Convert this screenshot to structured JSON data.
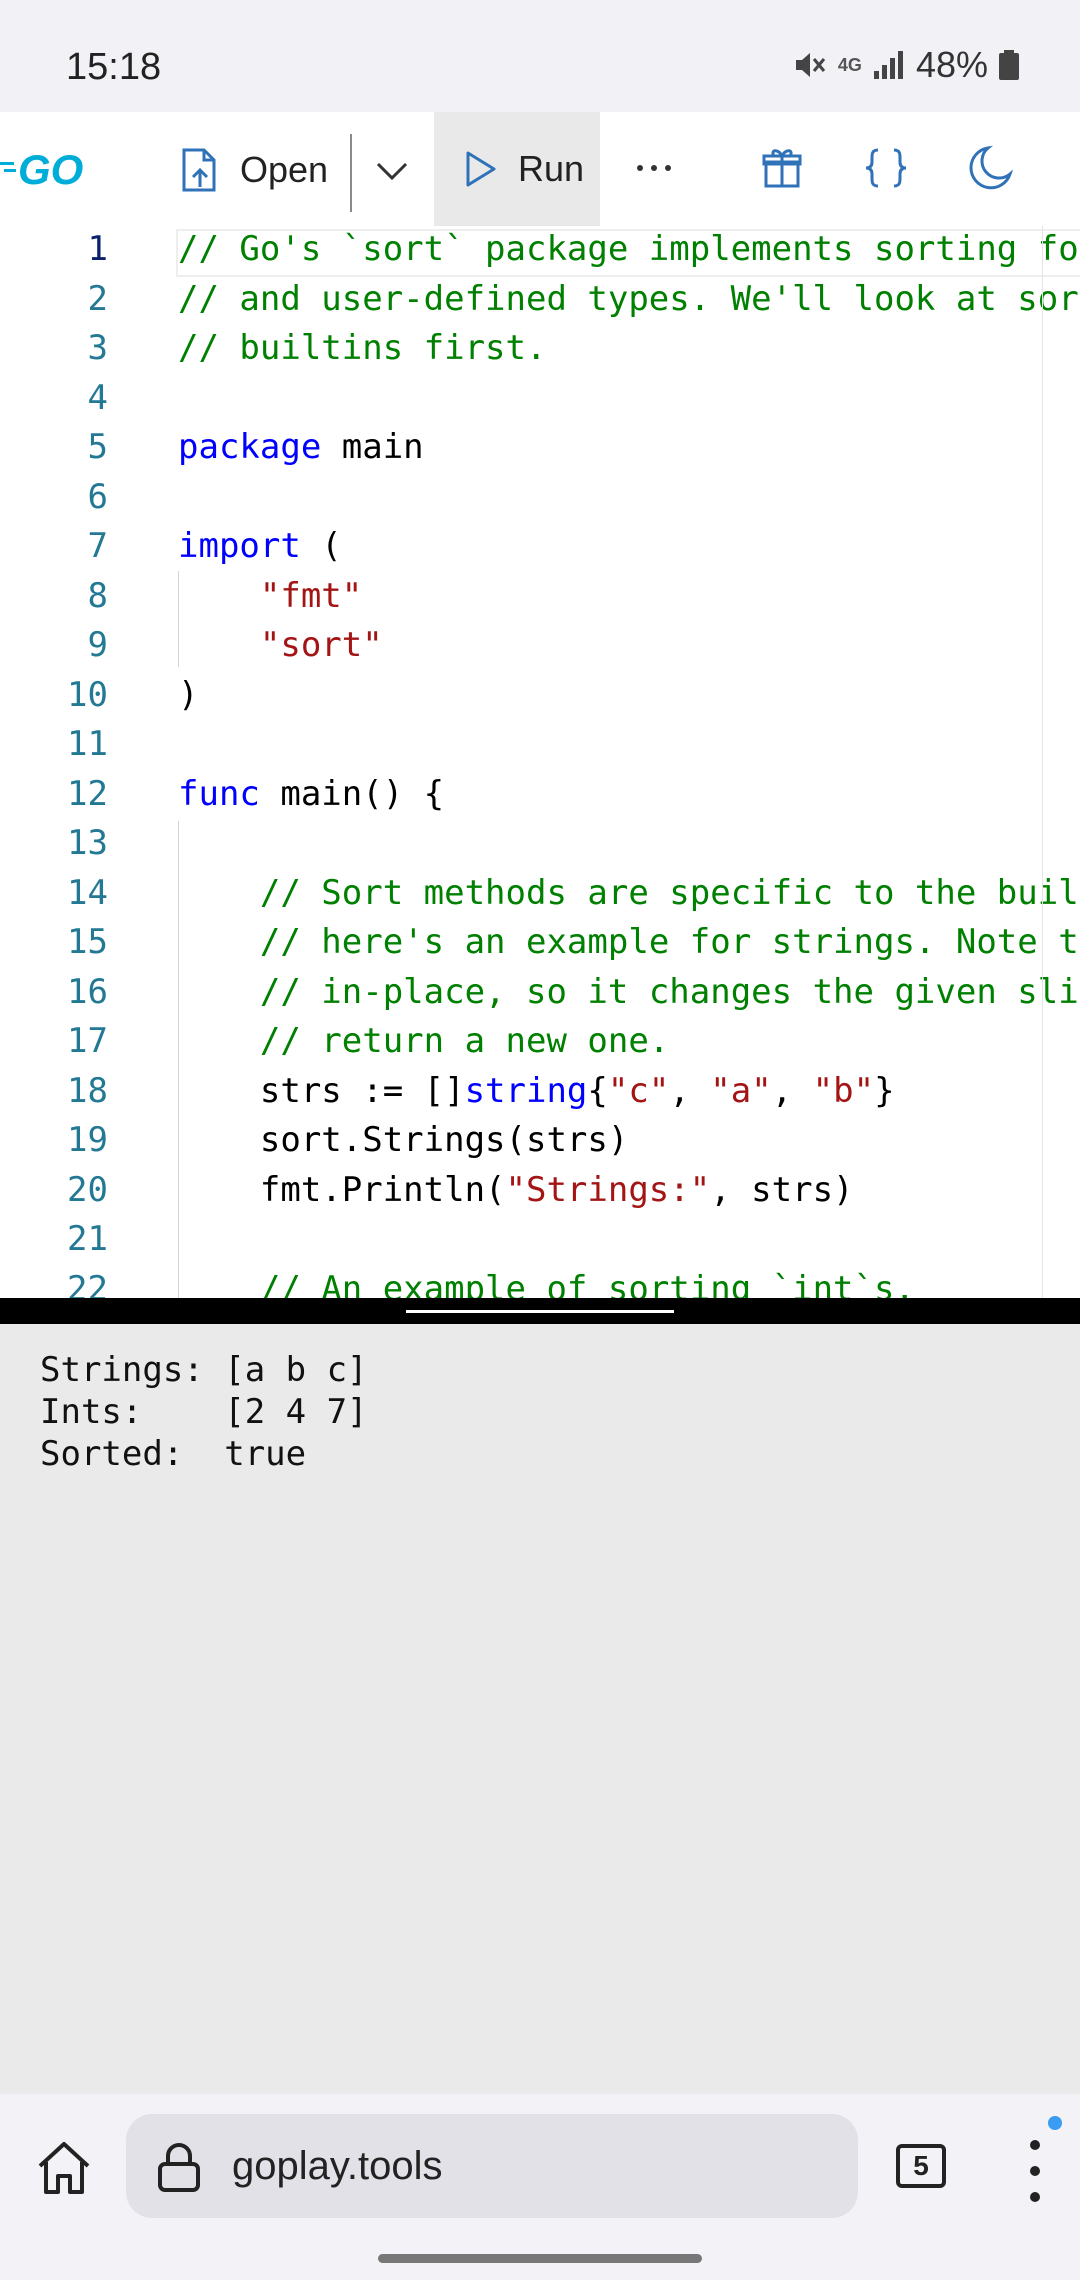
{
  "status_bar": {
    "time": "15:18",
    "network": "4G",
    "battery": "48%"
  },
  "toolbar": {
    "logo": "GO",
    "open_label": "Open",
    "run_label": "Run",
    "accent": "#2f72b8",
    "logo_color": "#00add8"
  },
  "editor": {
    "line_numbers": [
      "1",
      "2",
      "3",
      "4",
      "5",
      "6",
      "7",
      "8",
      "9",
      "10",
      "11",
      "12",
      "13",
      "14",
      "15",
      "16",
      "17",
      "18",
      "19",
      "20",
      "21",
      "22"
    ],
    "lines": [
      {
        "segs": [
          {
            "t": "// Go's `sort` package implements sorting for",
            "c": "com"
          }
        ]
      },
      {
        "segs": [
          {
            "t": "// and user-defined types. We'll look at sorting",
            "c": "com"
          }
        ]
      },
      {
        "segs": [
          {
            "t": "// builtins first.",
            "c": "com"
          }
        ]
      },
      {
        "segs": []
      },
      {
        "segs": [
          {
            "t": "package",
            "c": "kw"
          },
          {
            "t": " main",
            "c": ""
          }
        ]
      },
      {
        "segs": []
      },
      {
        "segs": [
          {
            "t": "import",
            "c": "kw"
          },
          {
            "t": " (",
            "c": ""
          }
        ]
      },
      {
        "segs": [
          {
            "t": "    ",
            "c": ""
          },
          {
            "t": "\"fmt\"",
            "c": "str"
          }
        ]
      },
      {
        "segs": [
          {
            "t": "    ",
            "c": ""
          },
          {
            "t": "\"sort\"",
            "c": "str"
          }
        ]
      },
      {
        "segs": [
          {
            "t": ")",
            "c": ""
          }
        ]
      },
      {
        "segs": []
      },
      {
        "segs": [
          {
            "t": "func",
            "c": "kw"
          },
          {
            "t": " main() {",
            "c": ""
          }
        ]
      },
      {
        "segs": []
      },
      {
        "segs": [
          {
            "t": "    ",
            "c": ""
          },
          {
            "t": "// Sort methods are specific to the builtin type;",
            "c": "com"
          }
        ]
      },
      {
        "segs": [
          {
            "t": "    ",
            "c": ""
          },
          {
            "t": "// here's an example for strings. Note that sorting is",
            "c": "com"
          }
        ]
      },
      {
        "segs": [
          {
            "t": "    ",
            "c": ""
          },
          {
            "t": "// in-place, so it changes the given slice and doesn't",
            "c": "com"
          }
        ]
      },
      {
        "segs": [
          {
            "t": "    ",
            "c": ""
          },
          {
            "t": "// return a new one.",
            "c": "com"
          }
        ]
      },
      {
        "segs": [
          {
            "t": "    strs := []",
            "c": ""
          },
          {
            "t": "string",
            "c": "type"
          },
          {
            "t": "{",
            "c": ""
          },
          {
            "t": "\"c\"",
            "c": "str"
          },
          {
            "t": ", ",
            "c": ""
          },
          {
            "t": "\"a\"",
            "c": "str"
          },
          {
            "t": ", ",
            "c": ""
          },
          {
            "t": "\"b\"",
            "c": "str"
          },
          {
            "t": "}",
            "c": ""
          }
        ]
      },
      {
        "segs": [
          {
            "t": "    sort.Strings(strs)",
            "c": ""
          }
        ]
      },
      {
        "segs": [
          {
            "t": "    fmt.Println(",
            "c": ""
          },
          {
            "t": "\"Strings:\"",
            "c": "str"
          },
          {
            "t": ", strs)",
            "c": ""
          }
        ]
      },
      {
        "segs": []
      },
      {
        "segs": [
          {
            "t": "    ",
            "c": ""
          },
          {
            "t": "// An example of sorting `int`s.",
            "c": "com"
          }
        ]
      }
    ]
  },
  "output": {
    "lines": [
      "Strings: [a b c]",
      "Ints:    [2 4 7]",
      "Sorted:  true"
    ]
  },
  "browser": {
    "url": "goplay.tools",
    "tab_count": "5"
  }
}
